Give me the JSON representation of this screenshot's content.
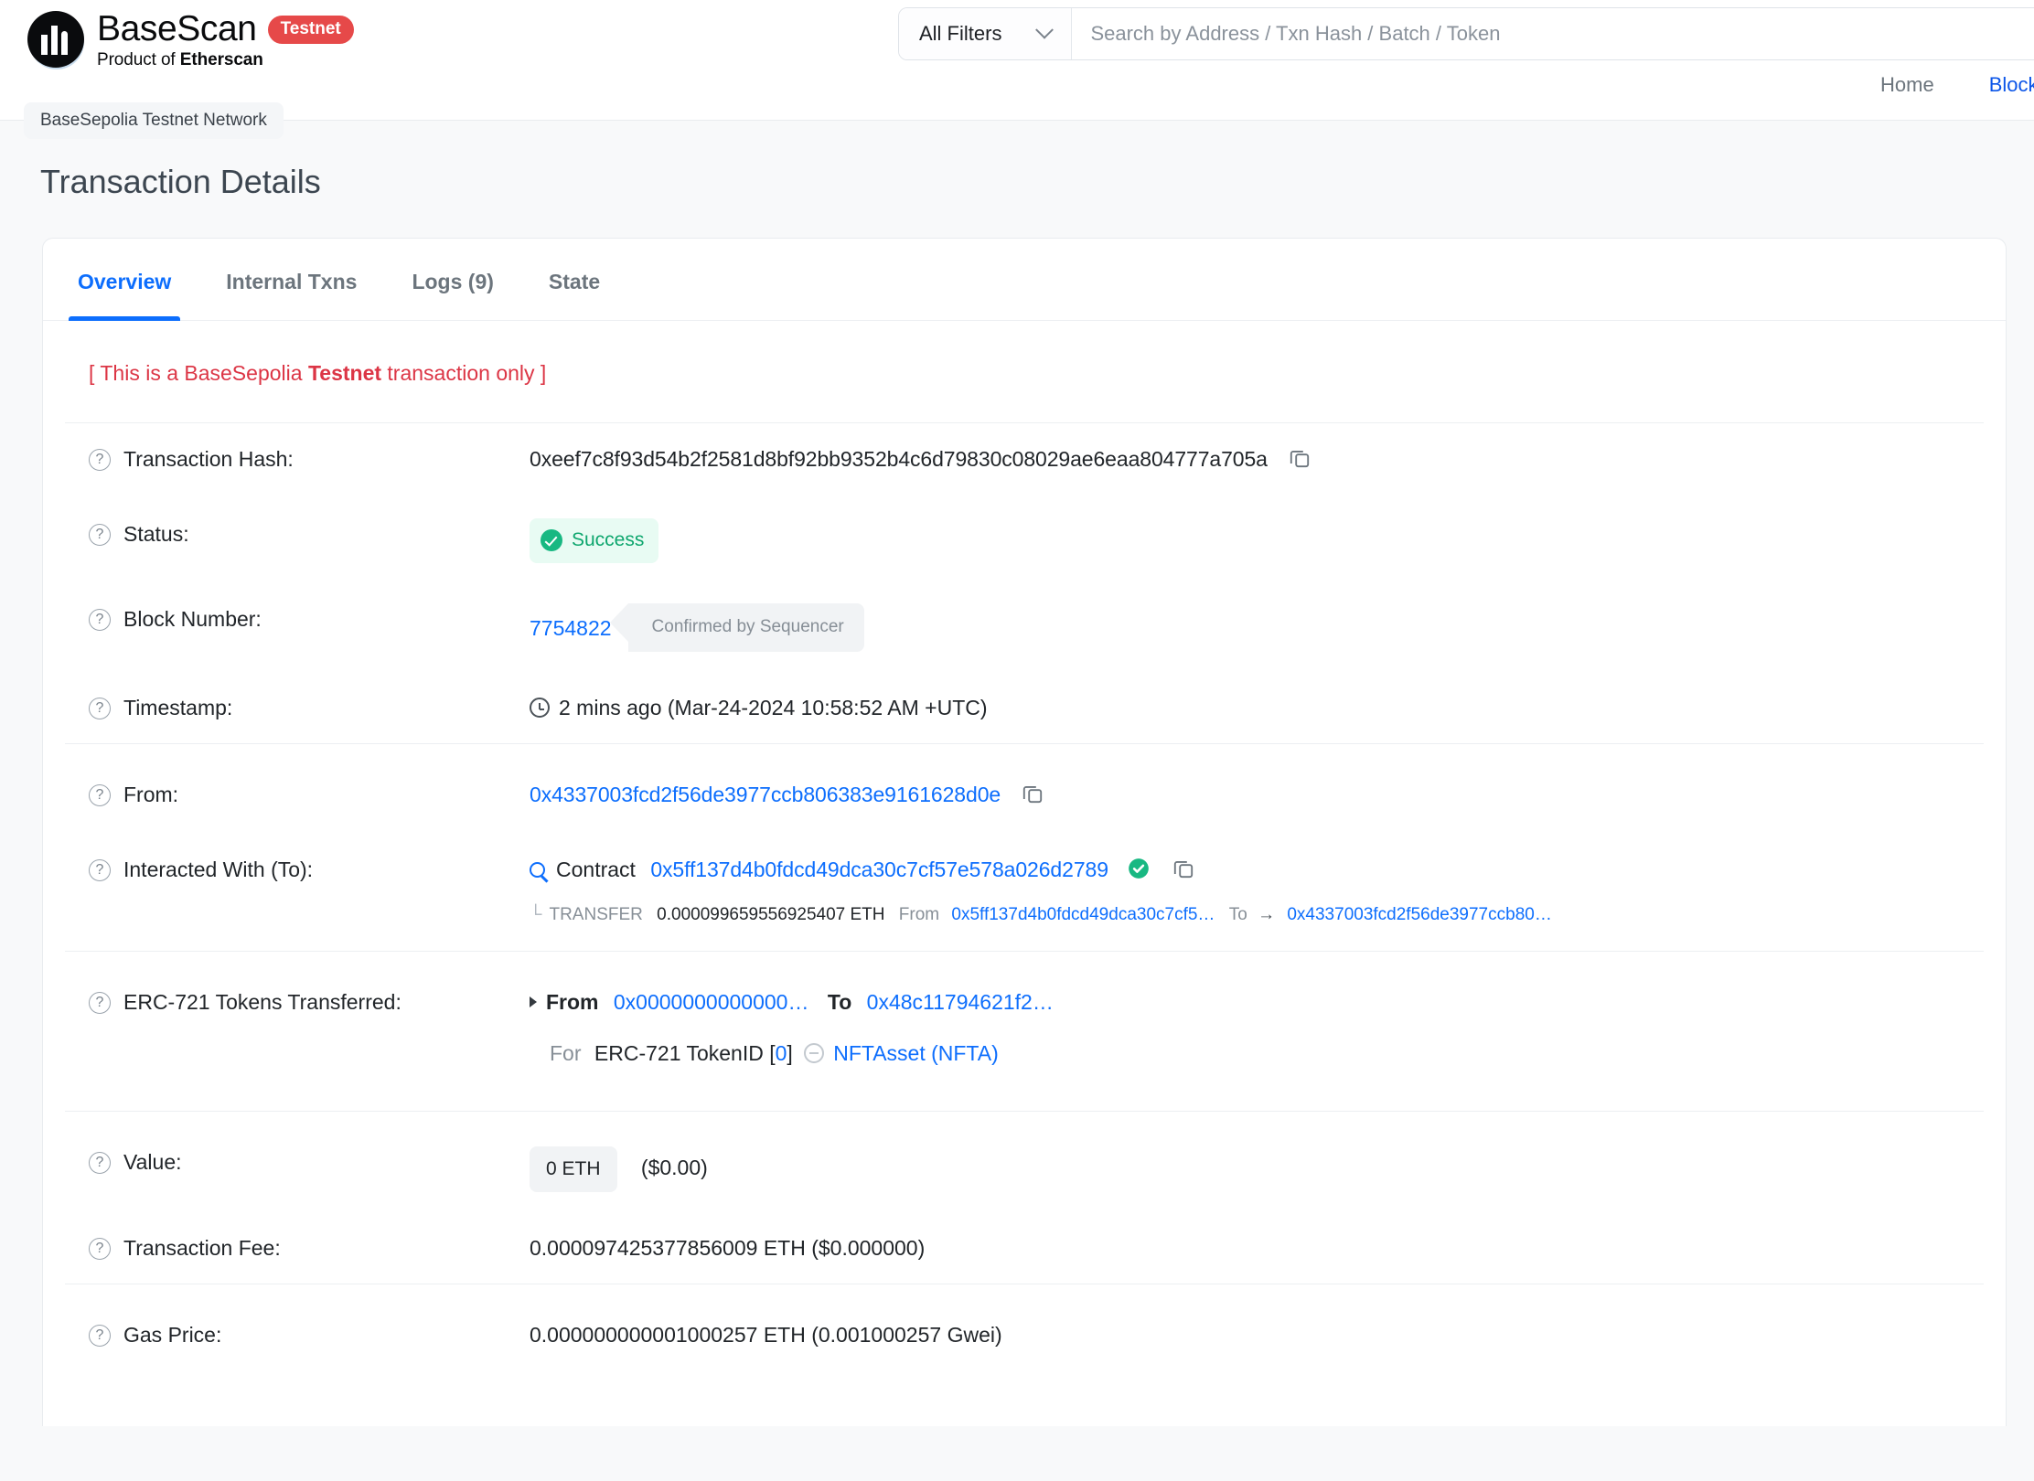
{
  "header": {
    "brand_name": "BaseScan",
    "brand_badge": "Testnet",
    "brand_sub_prefix": "Product of ",
    "brand_sub_strong": "Etherscan",
    "network_pill": "BaseSepolia Testnet Network",
    "filter_label": "All Filters",
    "search_placeholder": "Search by Address / Txn Hash / Batch / Token",
    "search_value": "",
    "nav": [
      {
        "label": "Home",
        "is_link": false
      },
      {
        "label": "Blockcha",
        "is_link": true
      }
    ]
  },
  "page": {
    "title": "Transaction Details",
    "tabs": [
      {
        "label": "Overview",
        "active": true
      },
      {
        "label": "Internal Txns",
        "active": false
      },
      {
        "label": "Logs (9)",
        "active": false
      },
      {
        "label": "State",
        "active": false
      }
    ],
    "testnet_note": {
      "prefix": "[ This is a BaseSepolia ",
      "strong": "Testnet",
      "suffix": " transaction only ]"
    }
  },
  "details": {
    "transaction_hash": {
      "label": "Transaction Hash:",
      "value": "0xeef7c8f93d54b2f2581d8bf92bb9352b4c6d79830c08029ae6eaa804777a705a"
    },
    "status": {
      "label": "Status:",
      "value": "Success"
    },
    "block_number": {
      "label": "Block Number:",
      "value": "7754822",
      "badge": "Confirmed by Sequencer"
    },
    "timestamp": {
      "label": "Timestamp:",
      "value": "2 mins ago (Mar-24-2024 10:58:52 AM +UTC)"
    },
    "from": {
      "label": "From:",
      "value": "0x4337003fcd2f56de3977ccb806383e9161628d0e"
    },
    "interacted_with": {
      "label": "Interacted With (To):",
      "contract_word": "Contract",
      "address": "0x5ff137d4b0fdcd49dca30c7cf57e578a026d2789",
      "transfer": {
        "corner": "└",
        "word": "TRANSFER",
        "amount": "0.000099659556925407 ETH",
        "from_word": "From",
        "from_addr": "0x5ff137d4b0fdcd49dca30c7cf5…",
        "to_word": "To",
        "arrow": "→",
        "to_addr": "0x4337003fcd2f56de3977ccb80…"
      }
    },
    "erc721": {
      "label": "ERC-721 Tokens Transferred:",
      "from_word": "From",
      "from_addr": "0x0000000000000…",
      "to_word": "To",
      "to_addr": "0x48c11794621f2…",
      "for_word": "For",
      "token_text": "ERC-721 TokenID [",
      "token_id": "0",
      "token_text_close": "]",
      "token_name": "NFTAsset (NFTA)"
    },
    "value": {
      "label": "Value:",
      "chip": "0 ETH",
      "usd": "($0.00)"
    },
    "transaction_fee": {
      "label": "Transaction Fee:",
      "value": "0.000097425377856009 ETH ($0.000000)"
    },
    "gas_price": {
      "label": "Gas Price:",
      "value": "0.000000000001000257 ETH (0.001000257 Gwei)"
    }
  },
  "icons": {
    "copy": "copy-icon",
    "question": "?",
    "verified": "verified-check-icon"
  },
  "colors": {
    "link": "#0d6efd",
    "success": "#0ea66e",
    "danger": "#dc3545",
    "testnet_pill": "#e64949"
  }
}
